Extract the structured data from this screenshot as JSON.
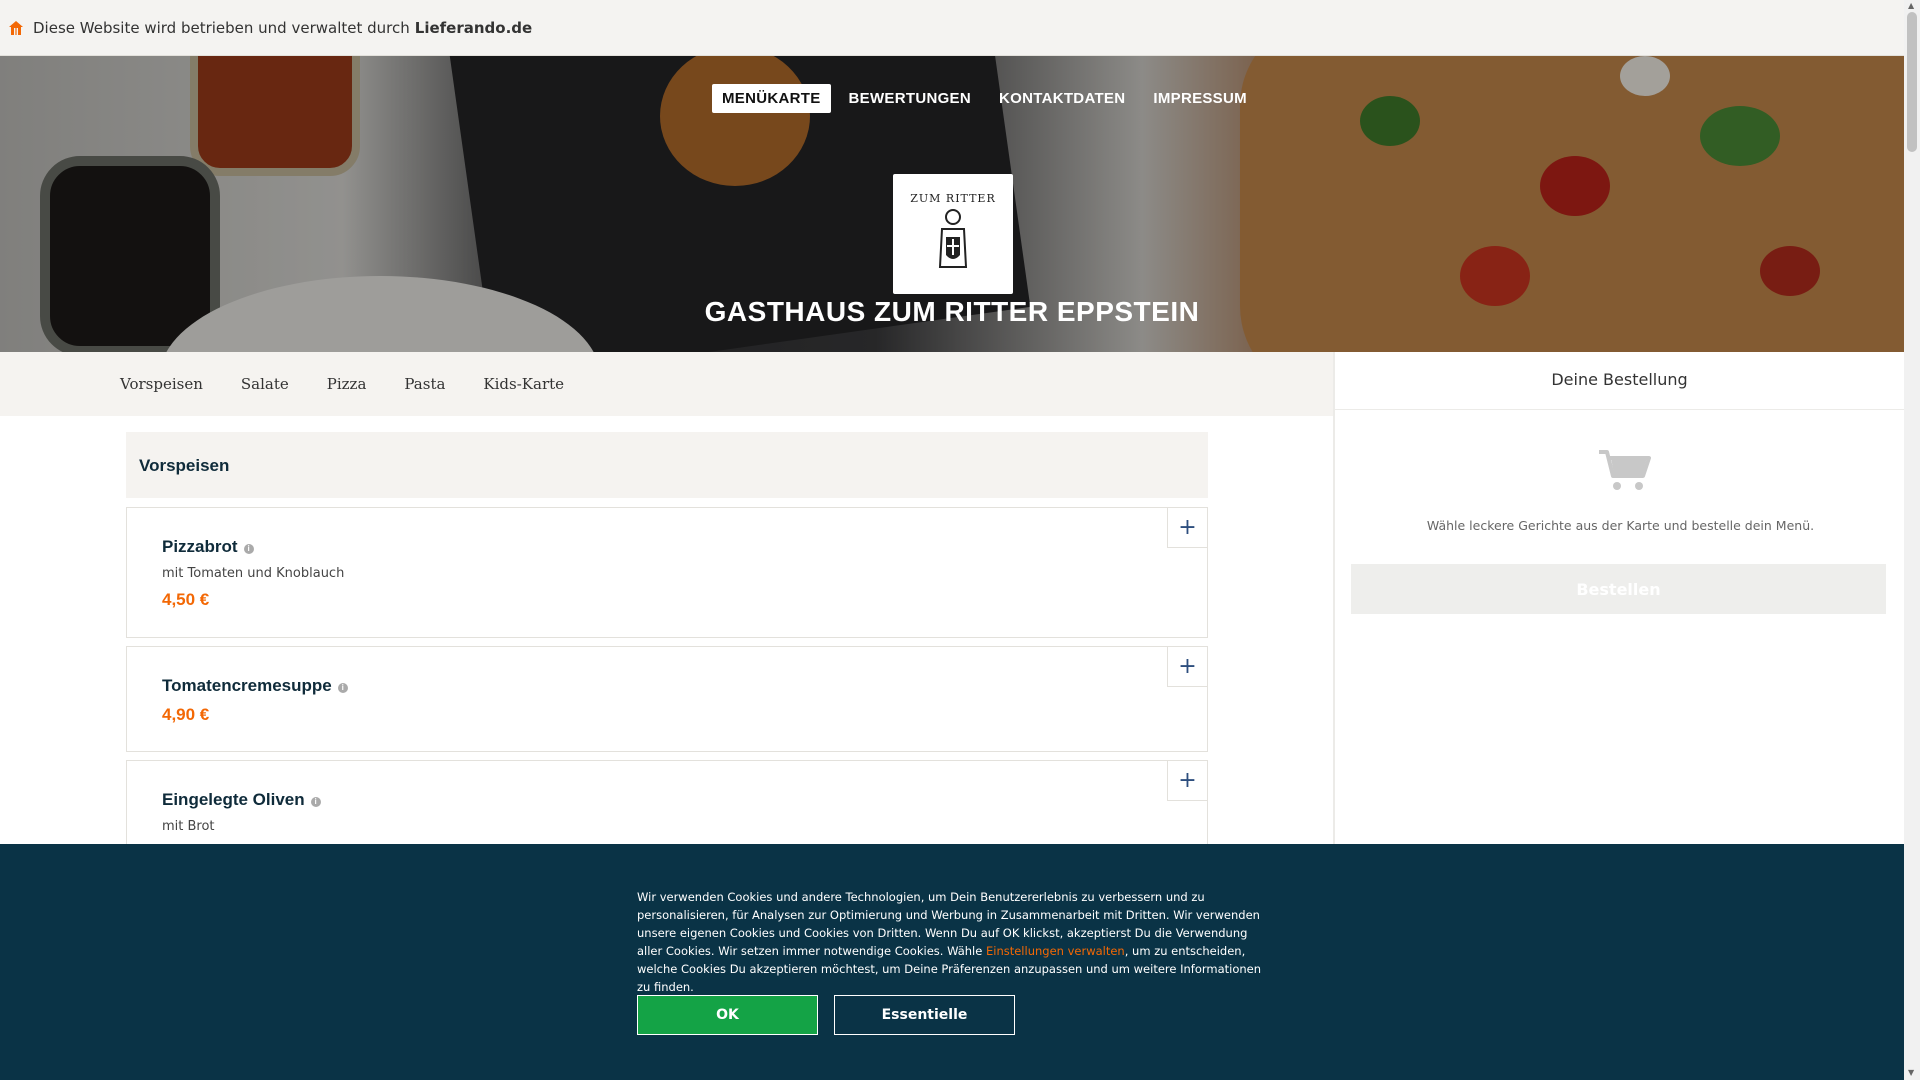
{
  "topbar": {
    "text": "Diese Website wird betrieben und verwaltet durch",
    "brand": "Lieferando.de",
    "icon": "house-icon",
    "icon_color": "#f36805"
  },
  "nav": {
    "items": [
      {
        "label": "MENÜKARTE",
        "active": true
      },
      {
        "label": "BEWERTUNGEN",
        "active": false
      },
      {
        "label": "KONTAKTDATEN",
        "active": false
      },
      {
        "label": "IMPRESSUM",
        "active": false
      }
    ]
  },
  "restaurant": {
    "logo_text": "ZUM RITTER",
    "name": "GASTHAUS ZUM RITTER EPPSTEIN"
  },
  "categories": [
    "Vorspeisen",
    "Salate",
    "Pizza",
    "Pasta",
    "Kids-Karte"
  ],
  "menu": {
    "section_title": "Vorspeisen",
    "items": [
      {
        "name": "Pizzabrot",
        "description": "mit Tomaten und Knoblauch",
        "price": "4,50 €"
      },
      {
        "name": "Tomatencremesuppe",
        "description": "",
        "price": "4,90 €"
      },
      {
        "name": "Eingelegte Oliven",
        "description": "mit Brot",
        "price": ""
      }
    ],
    "add_label": "+",
    "info_label": "i"
  },
  "order": {
    "title": "Deine Bestellung",
    "empty_text": "Wähle leckere Gerichte aus der Karte und bestelle dein Menü.",
    "button_label": "Bestellen",
    "icon": "cart-icon"
  },
  "cookie": {
    "text_before": "Wir verwenden Cookies und andere Technologien, um Dein Benutzererlebnis zu verbessern und zu personalisieren, für Analysen zur Optimierung und Werbung in Zusammenarbeit mit Dritten. Wir verwenden unsere eigenen Cookies und Cookies von Dritten. Wenn Du auf OK klickst, akzeptierst Du die Verwendung aller Cookies. Wir setzen immer notwendige Cookies. Wähle ",
    "link_text": "Einstellungen verwalten",
    "text_after": ", um zu entscheiden, welche Cookies Du akzeptieren möchtest, um Deine Präferenzen anzupassen und um weitere Informationen zu finden.",
    "ok_label": "OK",
    "essential_label": "Essentielle"
  },
  "colors": {
    "accent": "#f36805",
    "ok_green": "#14a346",
    "cookie_bg": "#0a3346",
    "heading": "#0f2b3a"
  }
}
